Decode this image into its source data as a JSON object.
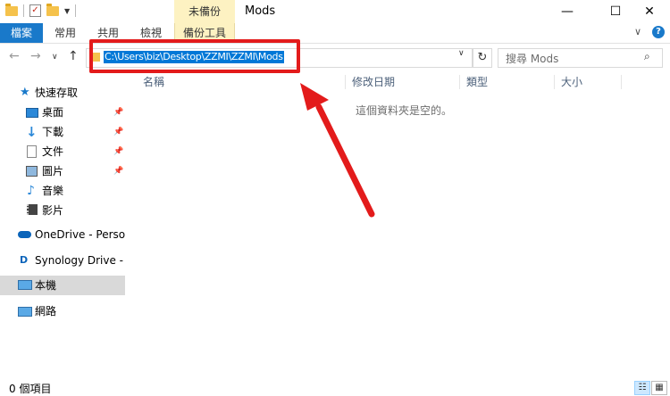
{
  "window": {
    "title": "Mods",
    "contextual_header": "未備份",
    "controls": {
      "minimize": "—",
      "maximize": "☐",
      "close": "✕"
    }
  },
  "ribbon": {
    "tabs": [
      {
        "label": "檔案"
      },
      {
        "label": "常用"
      },
      {
        "label": "共用"
      },
      {
        "label": "檢視"
      },
      {
        "label": "備份工具"
      }
    ],
    "expand_glyph": "∨",
    "help_glyph": "?"
  },
  "navigation": {
    "back": "←",
    "forward": "→",
    "recent": "∨",
    "up": "↑",
    "address_path": "C:\\Users\\biz\\Desktop\\ZZMI\\ZZMI\\Mods",
    "address_dropdown": "∨",
    "refresh": "↻",
    "search_placeholder": "搜尋 Mods",
    "search_glyph": "⌕"
  },
  "sidebar": {
    "quick_access": "快速存取",
    "quick_items": [
      {
        "label": "桌面",
        "icon": "desktop-icon"
      },
      {
        "label": "下載",
        "icon": "download-icon"
      },
      {
        "label": "文件",
        "icon": "document-icon"
      },
      {
        "label": "圖片",
        "icon": "picture-icon"
      },
      {
        "label": "音樂",
        "icon": "music-icon"
      },
      {
        "label": "影片",
        "icon": "video-icon"
      }
    ],
    "onedrive": "OneDrive - Personal",
    "synology": "Synology Drive - Oc",
    "this_pc": "本機",
    "network": "網路",
    "pin_glyph": "📌"
  },
  "columns": [
    "名稱",
    "修改日期",
    "類型",
    "大小"
  ],
  "empty_message": "這個資料夾是空的。",
  "status": {
    "item_count": "0 個項目",
    "details_view": "☷",
    "tiles_view": "▦"
  },
  "colors": {
    "accent": "#1979ca",
    "selection": "#0078d7",
    "highlight": "#e31b1b",
    "contextual_tab": "#fdf2c2"
  }
}
